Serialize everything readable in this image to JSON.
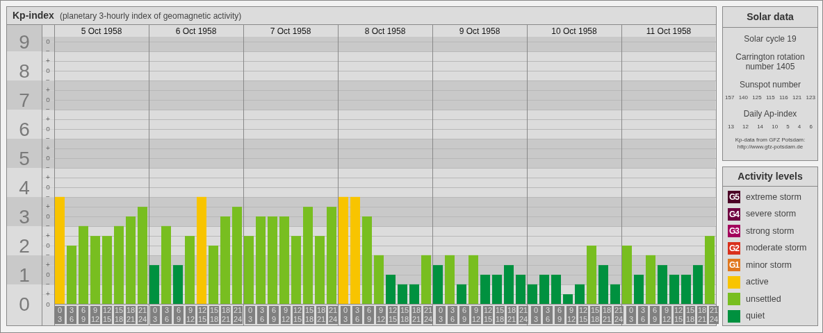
{
  "kp_panel": {
    "title": "Kp-index",
    "subtitle": "(planetary 3-hourly index of geomagnetic activity)",
    "days": [
      "5 Oct 1958",
      "6 Oct 1958",
      "7 Oct 1958",
      "8 Oct 1958",
      "9 Oct 1958",
      "10 Oct 1958",
      "11 Oct 1958"
    ],
    "sub_ticks": [
      "o",
      "−",
      "+",
      "o",
      "−",
      "+",
      "o",
      "−",
      "+",
      "o",
      "−",
      "+",
      "o",
      "−",
      "+",
      "o",
      "−",
      "+",
      "o",
      "−",
      "+",
      "o",
      "−",
      "+",
      "o",
      "−",
      "+",
      "o"
    ],
    "chart_data": {
      "type": "bar",
      "grid": true,
      "ylim": [
        0,
        9.57
      ],
      "yticks": [
        0,
        1,
        2,
        3,
        4,
        5,
        6,
        7,
        8,
        9
      ],
      "categories": [
        "0 3",
        "3 6",
        "6 9",
        "9 12",
        "12 15",
        "15 18",
        "18 21",
        "21 24",
        "0 3",
        "3 6",
        "6 9",
        "9 12",
        "12 15",
        "15 18",
        "18 21",
        "21 24",
        "0 3",
        "3 6",
        "6 9",
        "9 12",
        "12 15",
        "15 18",
        "18 21",
        "21 24",
        "0 3",
        "3 6",
        "6 9",
        "9 12",
        "12 15",
        "15 18",
        "18 21",
        "21 24",
        "0 3",
        "3 6",
        "6 9",
        "9 12",
        "12 15",
        "15 18",
        "18 21",
        "21 24",
        "0 3",
        "3 6",
        "6 9",
        "9 12",
        "12 15",
        "15 18",
        "18 21",
        "21 24",
        "0 3",
        "3 6",
        "6 9",
        "9 12",
        "12 15",
        "15 18",
        "18 21",
        "21 24"
      ],
      "series": [
        {
          "color": "#f8c400",
          "values": [
            3.67,
            null,
            null,
            null,
            null,
            null,
            null,
            null,
            null,
            null,
            null,
            null,
            3.67,
            null,
            null,
            null,
            null,
            null,
            null,
            null,
            null,
            null,
            null,
            null,
            3.67,
            3.67,
            null,
            null,
            null,
            null,
            null,
            null,
            null,
            null,
            null,
            null,
            null,
            null,
            null,
            null,
            null,
            null,
            null,
            null,
            null,
            null,
            null,
            null,
            null,
            null,
            null,
            null,
            null,
            null,
            null,
            null
          ]
        },
        {
          "color": "#78be20",
          "values": [
            null,
            2,
            2.67,
            2.33,
            2.33,
            2.67,
            3,
            3.33,
            null,
            2.67,
            null,
            2.33,
            null,
            2,
            3,
            3.33,
            2.33,
            3,
            3,
            3,
            2.33,
            3.33,
            2.33,
            3.33,
            null,
            null,
            3,
            1.67,
            null,
            null,
            null,
            1.67,
            null,
            1.67,
            null,
            1.67,
            null,
            null,
            null,
            null,
            null,
            null,
            null,
            null,
            null,
            2,
            null,
            null,
            2,
            null,
            1.67,
            null,
            null,
            null,
            null,
            2.33
          ]
        },
        {
          "color": "#00913f",
          "values": [
            null,
            null,
            null,
            null,
            null,
            null,
            null,
            null,
            1.33,
            null,
            1.33,
            null,
            null,
            null,
            null,
            null,
            null,
            null,
            null,
            null,
            null,
            null,
            null,
            null,
            null,
            null,
            null,
            null,
            1,
            0.67,
            0.67,
            null,
            1.33,
            null,
            0.67,
            null,
            1,
            1,
            1.33,
            1,
            0.67,
            1,
            1,
            0.33,
            0.67,
            null,
            1.33,
            0.67,
            null,
            1,
            null,
            1.33,
            1,
            1,
            1.33,
            null
          ]
        }
      ]
    }
  },
  "solar_data": {
    "title": "Solar data",
    "cycle": "Solar cycle 19",
    "carrington": "Carrington rotation number 1405",
    "sunspot_label": "Sunspot number",
    "sunspot_values": [
      "157",
      "140",
      "125",
      "115",
      "116",
      "121",
      "123"
    ],
    "ap_label": "Daily Ap-index",
    "ap_values": [
      "13",
      "12",
      "14",
      "10",
      "5",
      "4",
      "6"
    ],
    "source": "Kp-data from GFZ Potsdam:",
    "source_link": "http://www.gfz-potsdam.de"
  },
  "legend": {
    "title": "Activity levels",
    "items": [
      {
        "badge": "G5",
        "label": "extreme storm",
        "color": "#4b0026"
      },
      {
        "badge": "G4",
        "label": "severe storm",
        "color": "#6e0040"
      },
      {
        "badge": "G3",
        "label": "strong storm",
        "color": "#a3005c"
      },
      {
        "badge": "G2",
        "label": "moderate storm",
        "color": "#d9301c"
      },
      {
        "badge": "G1",
        "label": "minor storm",
        "color": "#e0781f"
      },
      {
        "label": "active",
        "color": "#f8c400"
      },
      {
        "label": "unsettled",
        "color": "#78be20"
      },
      {
        "label": "quiet",
        "color": "#00913f"
      }
    ]
  }
}
